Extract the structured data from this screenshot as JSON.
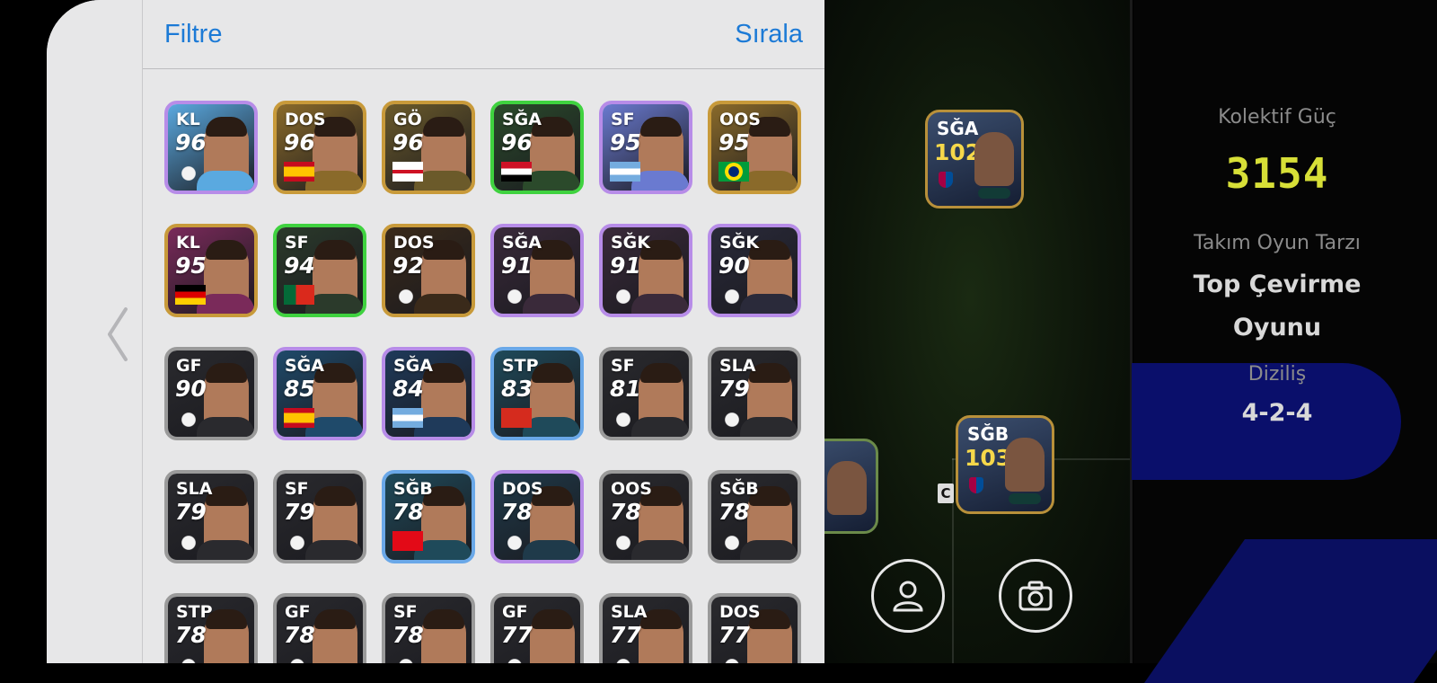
{
  "header": {
    "filter_label": "Filtre",
    "sort_label": "Sırala"
  },
  "right_panel": {
    "collective_label": "Kolektif Güç",
    "collective_value": "3154",
    "team_style_label": "Takım Oyun Tarzı",
    "team_style_value_line1": "Top Çevirme",
    "team_style_value_line2": "Oyunu",
    "formation_label": "Diziliş",
    "formation_value": "4-2-4"
  },
  "pitch": {
    "cards": [
      {
        "position": "SĞA",
        "rating": "102"
      },
      {
        "position": "SĞB",
        "rating": "103"
      }
    ],
    "captain_mark": "C",
    "buttons": [
      "profile-icon",
      "camera-icon"
    ]
  },
  "players": [
    {
      "position": "KL",
      "rating": "96",
      "frame": "#b78ce8",
      "bg": "#5aa9e0",
      "flag": "club-crest"
    },
    {
      "position": "DOS",
      "rating": "96",
      "frame": "#c89a3a",
      "bg": "#8a6a2a",
      "flag": "spain"
    },
    {
      "position": "GÖ",
      "rating": "96",
      "frame": "#c89a3a",
      "bg": "#6b5a2a",
      "flag": "england"
    },
    {
      "position": "SĞA",
      "rating": "96",
      "frame": "#3fd23f",
      "bg": "#2b4a2b",
      "flag": "egypt"
    },
    {
      "position": "SF",
      "rating": "95",
      "frame": "#b78ce8",
      "bg": "#6a7ad0",
      "flag": "argentina"
    },
    {
      "position": "OOS",
      "rating": "95",
      "frame": "#c89a3a",
      "bg": "#8a6a2a",
      "flag": "brazil"
    },
    {
      "position": "KL",
      "rating": "95",
      "frame": "#c89a3a",
      "bg": "#7a2a5a",
      "flag": "germany"
    },
    {
      "position": "SF",
      "rating": "94",
      "frame": "#3fd23f",
      "bg": "#2b3a2b",
      "flag": "portugal"
    },
    {
      "position": "DOS",
      "rating": "92",
      "frame": "#c89a3a",
      "bg": "#3a2a1a",
      "flag": "club-crest"
    },
    {
      "position": "SĞA",
      "rating": "91",
      "frame": "#b78ce8",
      "bg": "#3a2a3a",
      "flag": "club-crest"
    },
    {
      "position": "SĞK",
      "rating": "91",
      "frame": "#b78ce8",
      "bg": "#3a2a3a",
      "flag": "club-crest"
    },
    {
      "position": "SĞK",
      "rating": "90",
      "frame": "#b78ce8",
      "bg": "#2a2a3a",
      "flag": "club-crest"
    },
    {
      "position": "GF",
      "rating": "90",
      "frame": "#9a9a9a",
      "bg": "#2a2a2e",
      "flag": "club-crest"
    },
    {
      "position": "SĞA",
      "rating": "85",
      "frame": "#b78ce8",
      "bg": "#1f4a6a",
      "flag": "spain"
    },
    {
      "position": "SĞA",
      "rating": "84",
      "frame": "#b78ce8",
      "bg": "#1f3a5a",
      "flag": "argentina"
    },
    {
      "position": "STP",
      "rating": "83",
      "frame": "#6aa8e8",
      "bg": "#1f4a5a",
      "flag": "switzerland"
    },
    {
      "position": "SF",
      "rating": "81",
      "frame": "#9a9a9a",
      "bg": "#2a2a2e",
      "flag": "club-crest"
    },
    {
      "position": "SLA",
      "rating": "79",
      "frame": "#9a9a9a",
      "bg": "#2a2a2e",
      "flag": "club-crest"
    },
    {
      "position": "SLA",
      "rating": "79",
      "frame": "#9a9a9a",
      "bg": "#2a2a2e",
      "flag": "club-crest"
    },
    {
      "position": "SF",
      "rating": "79",
      "frame": "#9a9a9a",
      "bg": "#2a2a2e",
      "flag": "club-crest"
    },
    {
      "position": "SĞB",
      "rating": "78",
      "frame": "#6aa8e8",
      "bg": "#1f4a5a",
      "flag": "turkey"
    },
    {
      "position": "DOS",
      "rating": "78",
      "frame": "#b78ce8",
      "bg": "#1f3a4a",
      "flag": "club-crest"
    },
    {
      "position": "OOS",
      "rating": "78",
      "frame": "#9a9a9a",
      "bg": "#2a2a2e",
      "flag": "club-crest"
    },
    {
      "position": "SĞB",
      "rating": "78",
      "frame": "#9a9a9a",
      "bg": "#2a2a2e",
      "flag": "club-crest"
    },
    {
      "position": "STP",
      "rating": "78",
      "frame": "#9a9a9a",
      "bg": "#2a2a2e",
      "flag": "club-crest"
    },
    {
      "position": "GF",
      "rating": "78",
      "frame": "#9a9a9a",
      "bg": "#2a2a2e",
      "flag": "club-crest"
    },
    {
      "position": "SF",
      "rating": "78",
      "frame": "#9a9a9a",
      "bg": "#2a2a2e",
      "flag": "club-crest"
    },
    {
      "position": "GF",
      "rating": "77",
      "frame": "#9a9a9a",
      "bg": "#2a2a2e",
      "flag": "club-crest"
    },
    {
      "position": "SLA",
      "rating": "77",
      "frame": "#9a9a9a",
      "bg": "#2a2a2e",
      "flag": "club-crest"
    },
    {
      "position": "DOS",
      "rating": "77",
      "frame": "#9a9a9a",
      "bg": "#2a2a2e",
      "flag": "club-crest"
    }
  ],
  "colors": {
    "accent_blue": "#1c7ad6",
    "panel_bg": "#e7e7e8",
    "power_yellow": "#d7df37"
  }
}
